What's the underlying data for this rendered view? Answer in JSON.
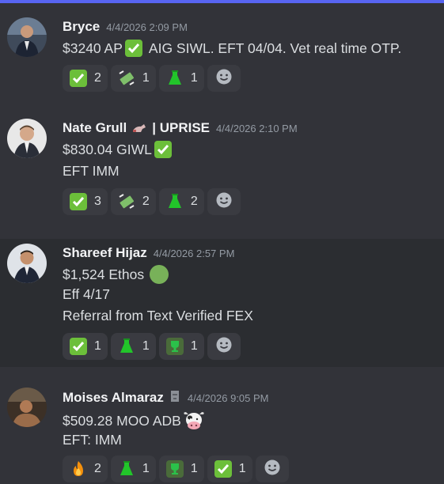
{
  "colors": {
    "accent_bar": "#5865f2",
    "background": "#323339",
    "highlight": "#2b2d31",
    "checkbox_green": "#6cbf3a"
  },
  "messages": [
    {
      "author": "Bryce",
      "timestamp": "4/4/2026 2:09 PM",
      "lines": [
        "$3240 AP",
        "AIG SIWL. EFT 04/04. Vet real time OTP."
      ],
      "reactions": [
        {
          "icon": "check-icon",
          "count": "2"
        },
        {
          "icon": "money-fly-icon",
          "count": "1"
        },
        {
          "icon": "flask-icon",
          "count": "1"
        }
      ]
    },
    {
      "author": "Nate Grull",
      "author_suffix": "| UPRISE",
      "timestamp": "4/4/2026 2:10 PM",
      "lines": [
        "$830.04 GIWL",
        "EFT IMM"
      ],
      "reactions": [
        {
          "icon": "check-icon",
          "count": "3"
        },
        {
          "icon": "money-fly-icon",
          "count": "2"
        },
        {
          "icon": "flask-icon",
          "count": "2"
        }
      ]
    },
    {
      "author": "Shareef Hijaz",
      "timestamp": "4/4/2026 2:57 PM",
      "lines": [
        "$1,524 Ethos",
        "Eff 4/17",
        "Referral from Text Verified FEX"
      ],
      "reactions": [
        {
          "icon": "check-icon",
          "count": "1"
        },
        {
          "icon": "flask-icon",
          "count": "1"
        },
        {
          "icon": "trophy-icon",
          "count": "1"
        }
      ]
    },
    {
      "author": "Moises Almaraz",
      "timestamp": "4/4/2026 9:05 PM",
      "lines": [
        "$509.28 MOO ADB",
        "EFT: IMM"
      ],
      "reactions": [
        {
          "icon": "fire-icon",
          "count": "2"
        },
        {
          "icon": "flask-icon",
          "count": "1"
        },
        {
          "icon": "trophy-icon",
          "count": "1"
        },
        {
          "icon": "check-icon",
          "count": "1"
        }
      ]
    }
  ]
}
